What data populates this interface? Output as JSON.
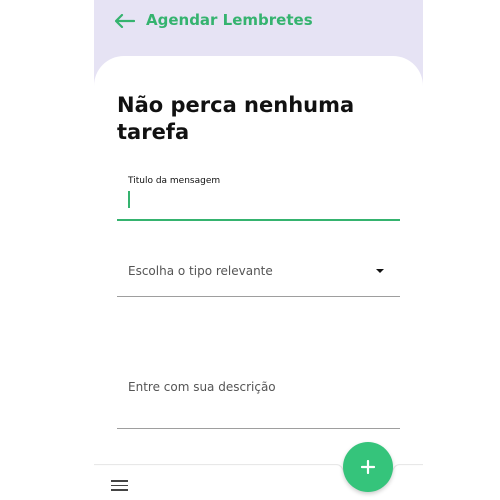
{
  "appbar": {
    "title": "Agendar Lembretes",
    "back_icon": "arrow-left-icon",
    "accent_color": "#35b36f",
    "background_color": "#e6e3f4"
  },
  "main": {
    "heading": "Não perca nenhuma tarefa",
    "title_field": {
      "label": "Titulo da mensagem",
      "value": ""
    },
    "type_select": {
      "placeholder": "Escolha o tipo relevante",
      "icon": "dropdown-arrow-icon"
    },
    "description_field": {
      "placeholder": "Entre com sua descrição"
    }
  },
  "bottom_bar": {
    "menu_icon": "menu-icon",
    "fab_icon": "plus-icon",
    "fab_color": "#35c47b"
  }
}
